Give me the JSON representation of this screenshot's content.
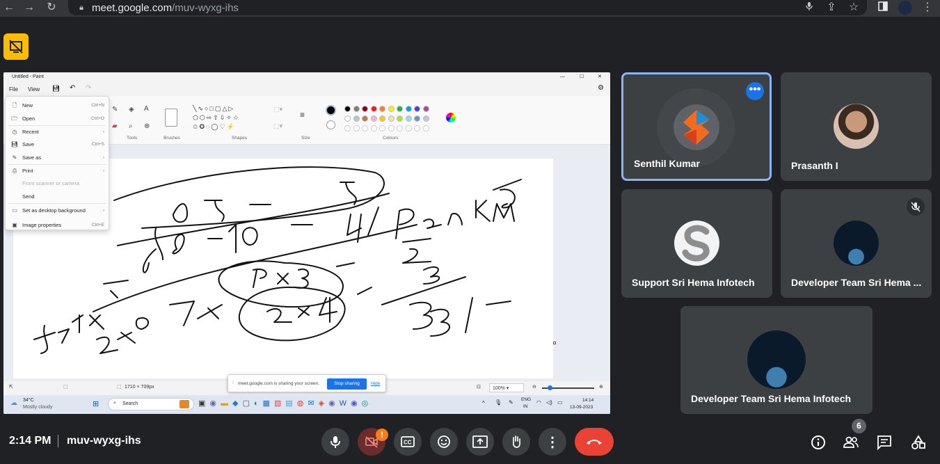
{
  "browser": {
    "url_host": "meet.google.com",
    "url_path": "/muv-wyxg-ihs"
  },
  "paint": {
    "title": "Untitled - Paint",
    "menu": {
      "file": "File",
      "view": "View"
    },
    "ribbon": {
      "tools": "Tools",
      "brushes": "Brushes",
      "shapes": "Shapes",
      "size": "Size",
      "colours": "Colours"
    },
    "file_menu": [
      {
        "label": "New",
        "shortcut": "Ctrl+N",
        "icon": "new-file-icon"
      },
      {
        "label": "Open",
        "shortcut": "Ctrl+O",
        "icon": "open-folder-icon"
      },
      {
        "label": "Recent",
        "shortcut": "›",
        "icon": "clock-icon"
      },
      {
        "label": "Save",
        "shortcut": "Ctrl+S",
        "icon": "save-icon"
      },
      {
        "label": "Save as",
        "shortcut": "›",
        "icon": "save-as-icon"
      },
      {
        "label": "Print",
        "shortcut": "›",
        "icon": "printer-icon"
      },
      {
        "label": "From scanner or camera",
        "shortcut": "",
        "icon": ""
      },
      {
        "label": "Send",
        "shortcut": "",
        "icon": ""
      },
      {
        "label": "Set as desktop background",
        "shortcut": "›",
        "icon": "desktop-icon"
      },
      {
        "label": "Image properties",
        "shortcut": "Ctrl+E",
        "icon": "image-properties-icon"
      }
    ],
    "canvas_size": "1710 × 709px",
    "zoom": "100%",
    "colors_row1": [
      "#000000",
      "#7f7f7f",
      "#880015",
      "#ed1c24",
      "#ff7f27",
      "#fff200",
      "#22b14c",
      "#00a2e8",
      "#3f48cc",
      "#a349a4"
    ],
    "colors_row2": [
      "#ffffff",
      "#c3c3c3",
      "#b97a57",
      "#ffaec9",
      "#ffc90e",
      "#efe4b0",
      "#b5e61d",
      "#99d9ea",
      "#7092be",
      "#c8bfe7"
    ]
  },
  "share_bar": {
    "message": "meet.google.com is sharing your screen.",
    "stop_label": "Stop sharing",
    "hide_label": "Hide"
  },
  "taskbar": {
    "temperature": "34°C",
    "weather": "Mostly cloudy",
    "search": "Search",
    "lang_top": "ENG",
    "lang_bottom": "IN",
    "time": "14:14",
    "date": "13-09-2023"
  },
  "participants": [
    {
      "name": "Senthil Kumar"
    },
    {
      "name": "Prasanth I"
    },
    {
      "name": "Support Sri Hema Infotech"
    },
    {
      "name": "Developer Team Sri Hema ..."
    },
    {
      "name": "Developer Team Sri Hema Infotech"
    }
  ],
  "meeting": {
    "time": "2:14 PM",
    "code": "muv-wyxg-ihs",
    "people_count": "6",
    "alert_badge": "!"
  }
}
